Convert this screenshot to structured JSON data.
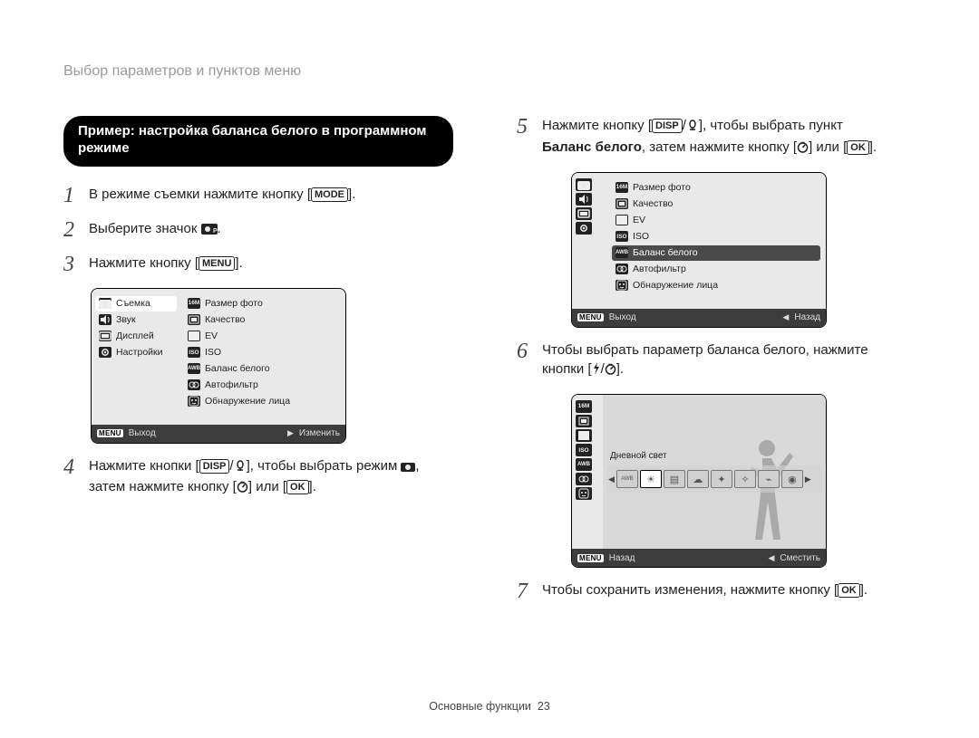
{
  "header": {
    "running_head": "Выбор параметров и пунктов меню"
  },
  "pill": {
    "line1": "Пример: настройка баланса белого в программном",
    "line2": "режиме"
  },
  "steps": {
    "s1": {
      "num": "1",
      "pre": "В режиме съемки нажмите кнопку [",
      "btn": "MODE",
      "post": "]."
    },
    "s2": {
      "num": "2",
      "pre": "Выберите значок ",
      "icon": "camera-p-icon",
      "post": "."
    },
    "s3": {
      "num": "3",
      "pre": "Нажмите кнопку [",
      "btn": "MENU",
      "post": "]."
    },
    "s4": {
      "num": "4",
      "pre": "Нажмите кнопки [",
      "btn": "DISP",
      "mid1": "/",
      "macro": "macro-icon",
      "mid2": "], чтобы выбрать режим ",
      "cam": "camera-icon",
      "mid3": ",",
      "line2_pre": "затем нажмите кнопку [",
      "timer": "timer-icon",
      "line2_mid": "] или [",
      "ok": "OK",
      "line2_post": "]."
    },
    "s5": {
      "num": "5",
      "pre": "Нажмите кнопку [",
      "btn": "DISP",
      "mid1": "/",
      "macro": "macro-icon",
      "mid2": "], чтобы выбрать пункт",
      "bold": "Баланс белого",
      "line2_mid": ", затем нажмите кнопку [",
      "timer": "timer-icon",
      "line2_mid2": "] или [",
      "ok": "OK",
      "line2_post": "]."
    },
    "s6": {
      "num": "6",
      "line1": "Чтобы выбрать параметр баланса белого, нажмите",
      "line2_pre": "кнопки [",
      "flash": "flash-icon",
      "line2_mid": "/",
      "timer": "timer-icon",
      "line2_post": "]."
    },
    "s7": {
      "num": "7",
      "pre": "Чтобы сохранить изменения, нажмите кнопку [",
      "ok": "OK",
      "post": "]."
    }
  },
  "lcd1": {
    "left": [
      {
        "icon": "camera-icon",
        "label": "Съемка",
        "sel": true
      },
      {
        "icon": "sound-icon",
        "label": "Звук",
        "sel": false
      },
      {
        "icon": "display-icon",
        "label": "Дисплей",
        "sel": false
      },
      {
        "icon": "gear-icon",
        "label": "Настройки",
        "sel": false
      }
    ],
    "right": [
      {
        "icon": "16m-icon",
        "label": "Размер фото"
      },
      {
        "icon": "quality-icon",
        "label": "Качество"
      },
      {
        "icon": "ev-icon",
        "label": "EV"
      },
      {
        "icon": "iso-icon",
        "label": "ISO"
      },
      {
        "icon": "wb-icon",
        "label": "Баланс белого"
      },
      {
        "icon": "filter-icon",
        "label": "Автофильтр"
      },
      {
        "icon": "face-icon",
        "label": "Обнаружение лица"
      }
    ],
    "footer": {
      "menu": "MENU",
      "exit": "Выход",
      "arrow": "▶",
      "action": "Изменить"
    }
  },
  "lcd2": {
    "rail": [
      {
        "icon": "camera-icon",
        "sel": false
      },
      {
        "icon": "sound-icon",
        "sel": false
      },
      {
        "icon": "display-icon",
        "sel": false
      },
      {
        "icon": "gear-icon",
        "sel": false
      }
    ],
    "right": [
      {
        "icon": "16m-icon",
        "label": "Размер фото",
        "sel": false
      },
      {
        "icon": "quality-icon",
        "label": "Качество",
        "sel": false
      },
      {
        "icon": "ev-icon",
        "label": "EV",
        "sel": false
      },
      {
        "icon": "iso-icon",
        "label": "ISO",
        "sel": false
      },
      {
        "icon": "wb-icon",
        "label": "Баланс белого",
        "sel": true
      },
      {
        "icon": "filter-icon",
        "label": "Автофильтр",
        "sel": false
      },
      {
        "icon": "face-icon",
        "label": "Обнаружение лица",
        "sel": false
      }
    ],
    "footer": {
      "menu": "MENU",
      "exit": "Выход",
      "arrow": "◀",
      "action": "Назад"
    }
  },
  "lcd3": {
    "rail": [
      "16m-icon",
      "quality-icon",
      "ev-icon",
      "iso-icon",
      "wb-icon",
      "filter-icon",
      "face-icon"
    ],
    "wb_label": "Дневной свет",
    "wb_icons": [
      "AWB",
      "sun",
      "shade",
      "cloud",
      "tungsten-h",
      "tungsten-l",
      "fluor",
      "custom"
    ],
    "wb_sel_index": 1,
    "footer": {
      "menu": "MENU",
      "back": "Назад",
      "arrow": "◀",
      "action": "Сместить"
    }
  },
  "footer": {
    "section": "Основные функции",
    "page": "23"
  }
}
